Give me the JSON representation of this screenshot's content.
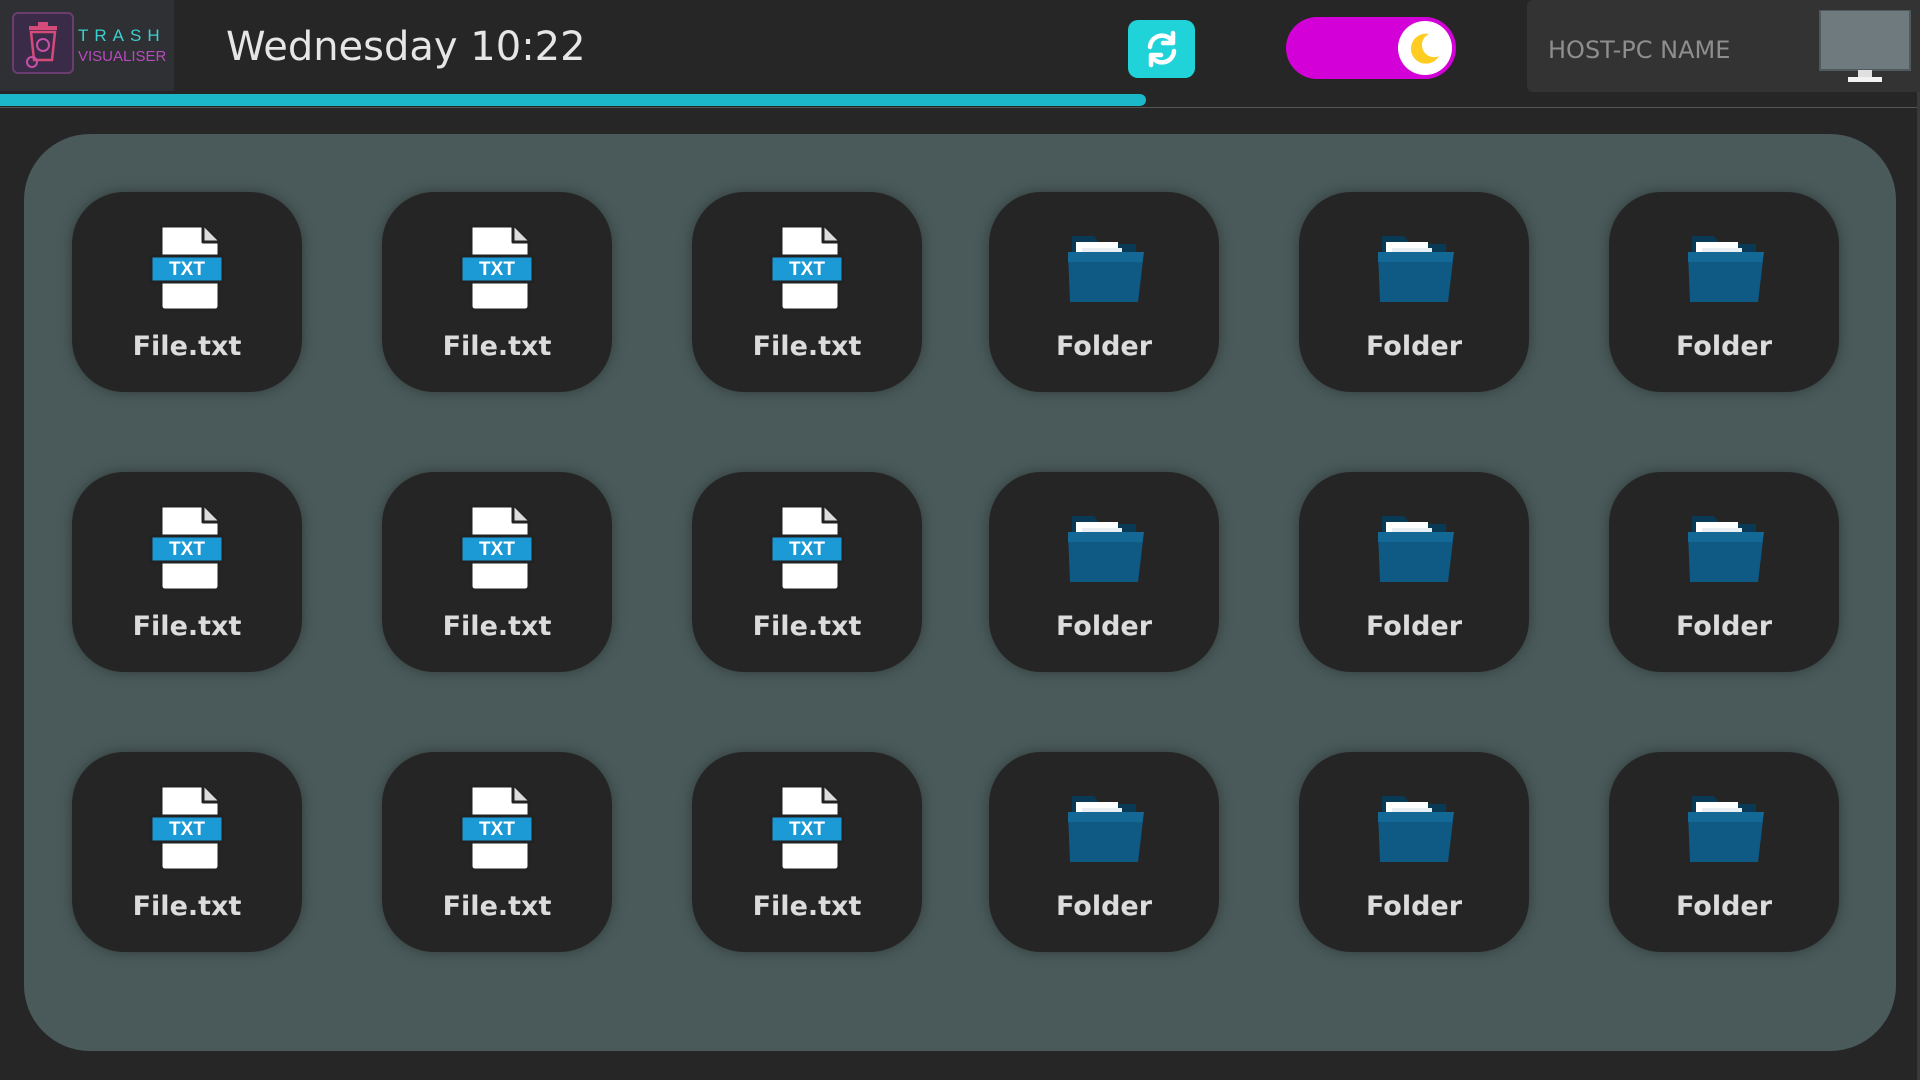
{
  "app": {
    "logo_line1": "TRASH",
    "logo_line2": "VISUALISER"
  },
  "header": {
    "datetime": "Wednesday 10:22",
    "host_name": "HOST-PC NAME",
    "refresh_icon": "refresh-icon",
    "theme_toggle_icon": "moon-icon",
    "monitor_icon": "monitor-icon"
  },
  "progress": {
    "fraction": 0.597
  },
  "colors": {
    "accent_cyan": "#1fd3d9",
    "toggle_magenta": "#d400d8",
    "tile_bg": "#252525",
    "panel_bg": "#4a5a5a",
    "folder_blue": "#0f5a85",
    "txt_badge": "#1b9ad6"
  },
  "tiles": [
    {
      "label": "File.txt",
      "type": "txt"
    },
    {
      "label": "File.txt",
      "type": "txt"
    },
    {
      "label": "File.txt",
      "type": "txt"
    },
    {
      "label": "Folder",
      "type": "folder"
    },
    {
      "label": "Folder",
      "type": "folder"
    },
    {
      "label": "Folder",
      "type": "folder"
    },
    {
      "label": "File.txt",
      "type": "txt"
    },
    {
      "label": "File.txt",
      "type": "txt"
    },
    {
      "label": "File.txt",
      "type": "txt"
    },
    {
      "label": "Folder",
      "type": "folder"
    },
    {
      "label": "Folder",
      "type": "folder"
    },
    {
      "label": "Folder",
      "type": "folder"
    },
    {
      "label": "File.txt",
      "type": "txt"
    },
    {
      "label": "File.txt",
      "type": "txt"
    },
    {
      "label": "File.txt",
      "type": "txt"
    },
    {
      "label": "Folder",
      "type": "folder"
    },
    {
      "label": "Folder",
      "type": "folder"
    },
    {
      "label": "Folder",
      "type": "folder"
    }
  ],
  "txt_badge_text": "TXT"
}
